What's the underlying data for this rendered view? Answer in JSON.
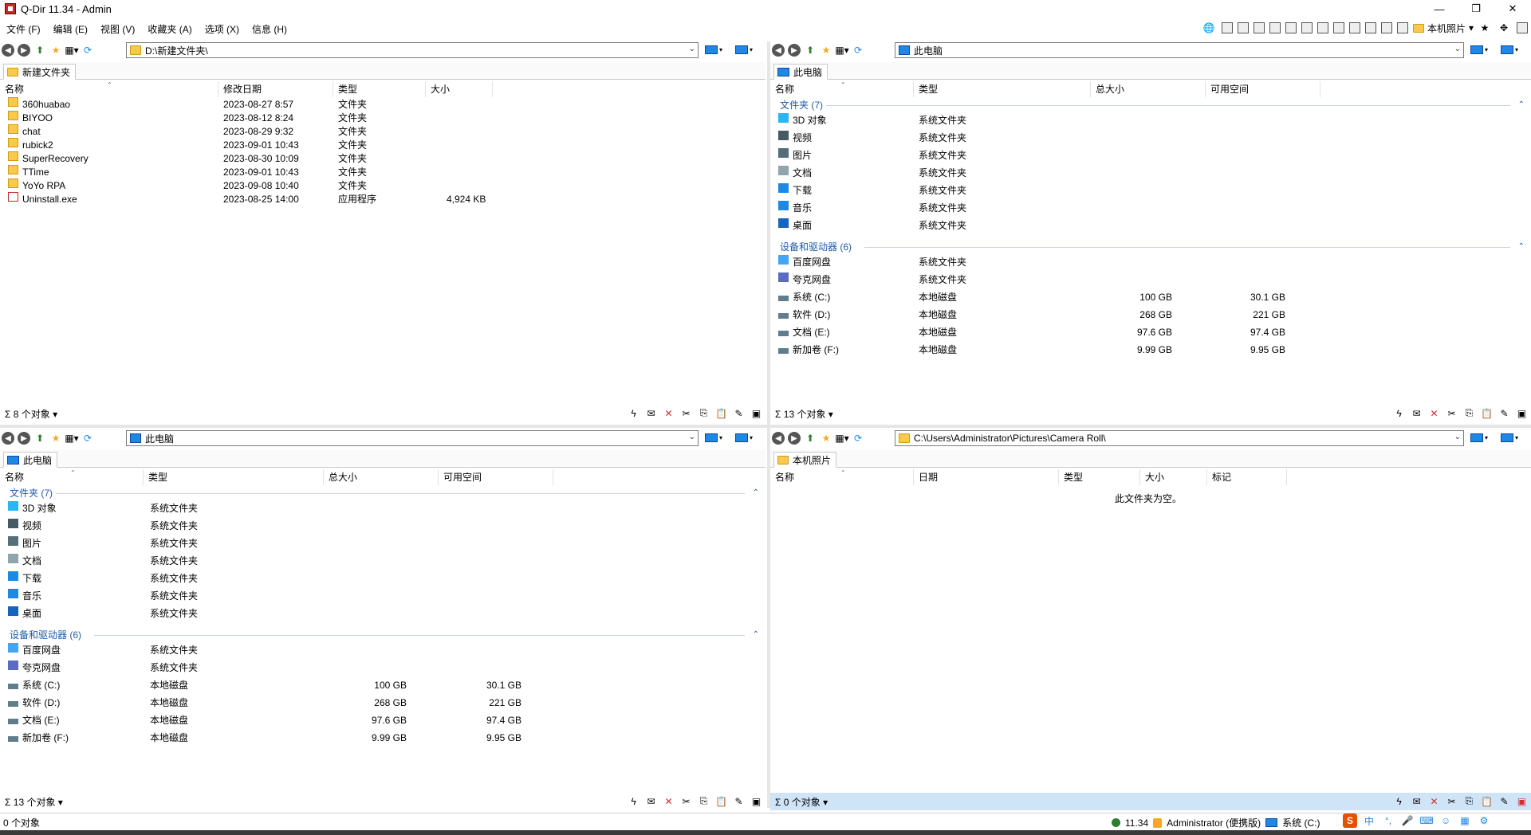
{
  "window": {
    "title": "Q-Dir 11.34 - Admin"
  },
  "menu": [
    "文件 (F)",
    "编辑 (E)",
    "视图 (V)",
    "收藏夹 (A)",
    "选项 (X)",
    "信息 (H)"
  ],
  "toolbar_right": {
    "label": "本机照片"
  },
  "panes": {
    "tl": {
      "address": "D:\\新建文件夹\\",
      "tab": "新建文件夹",
      "columns": [
        "名称",
        "修改日期",
        "类型",
        "大小"
      ],
      "rows": [
        {
          "name": "360huabao",
          "date": "2023-08-27 8:57",
          "type": "文件夹",
          "size": ""
        },
        {
          "name": "BIYOO",
          "date": "2023-08-12 8:24",
          "type": "文件夹",
          "size": ""
        },
        {
          "name": "chat",
          "date": "2023-08-29 9:32",
          "type": "文件夹",
          "size": ""
        },
        {
          "name": "rubick2",
          "date": "2023-09-01 10:43",
          "type": "文件夹",
          "size": ""
        },
        {
          "name": "SuperRecovery",
          "date": "2023-08-30 10:09",
          "type": "文件夹",
          "size": ""
        },
        {
          "name": "TTime",
          "date": "2023-09-01 10:43",
          "type": "文件夹",
          "size": ""
        },
        {
          "name": "YoYo RPA",
          "date": "2023-09-08 10:40",
          "type": "文件夹",
          "size": ""
        },
        {
          "name": "Uninstall.exe",
          "date": "2023-08-25 14:00",
          "type": "应用程序",
          "size": "4,924 KB"
        }
      ],
      "count": "8 个对象"
    },
    "tr": {
      "address": "此电脑",
      "tab": "此电脑",
      "columns": [
        "名称",
        "类型",
        "总大小",
        "可用空间"
      ],
      "group1": "文件夹 (7)",
      "group2": "设备和驱动器 (6)",
      "folders": [
        {
          "name": "3D 对象",
          "type": "系统文件夹"
        },
        {
          "name": "视频",
          "type": "系统文件夹"
        },
        {
          "name": "图片",
          "type": "系统文件夹"
        },
        {
          "name": "文档",
          "type": "系统文件夹"
        },
        {
          "name": "下载",
          "type": "系统文件夹"
        },
        {
          "name": "音乐",
          "type": "系统文件夹"
        },
        {
          "name": "桌面",
          "type": "系统文件夹"
        }
      ],
      "drives": [
        {
          "name": "百度网盘",
          "type": "系统文件夹",
          "total": "",
          "free": ""
        },
        {
          "name": "夸克网盘",
          "type": "系统文件夹",
          "total": "",
          "free": ""
        },
        {
          "name": "系统 (C:)",
          "type": "本地磁盘",
          "total": "100 GB",
          "free": "30.1 GB"
        },
        {
          "name": "软件 (D:)",
          "type": "本地磁盘",
          "total": "268 GB",
          "free": "221 GB"
        },
        {
          "name": "文档 (E:)",
          "type": "本地磁盘",
          "total": "97.6 GB",
          "free": "97.4 GB"
        },
        {
          "name": "新加卷 (F:)",
          "type": "本地磁盘",
          "total": "9.99 GB",
          "free": "9.95 GB"
        }
      ],
      "count": "13 个对象"
    },
    "bl": {
      "address": "此电脑",
      "tab": "此电脑",
      "columns": [
        "名称",
        "类型",
        "总大小",
        "可用空间"
      ],
      "group1": "文件夹 (7)",
      "group2": "设备和驱动器 (6)",
      "folders": [
        {
          "name": "3D 对象",
          "type": "系统文件夹"
        },
        {
          "name": "视频",
          "type": "系统文件夹"
        },
        {
          "name": "图片",
          "type": "系统文件夹"
        },
        {
          "name": "文档",
          "type": "系统文件夹"
        },
        {
          "name": "下载",
          "type": "系统文件夹"
        },
        {
          "name": "音乐",
          "type": "系统文件夹"
        },
        {
          "name": "桌面",
          "type": "系统文件夹"
        }
      ],
      "drives": [
        {
          "name": "百度网盘",
          "type": "系统文件夹",
          "total": "",
          "free": ""
        },
        {
          "name": "夸克网盘",
          "type": "系统文件夹",
          "total": "",
          "free": ""
        },
        {
          "name": "系统 (C:)",
          "type": "本地磁盘",
          "total": "100 GB",
          "free": "30.1 GB"
        },
        {
          "name": "软件 (D:)",
          "type": "本地磁盘",
          "total": "268 GB",
          "free": "221 GB"
        },
        {
          "name": "文档 (E:)",
          "type": "本地磁盘",
          "total": "97.6 GB",
          "free": "97.4 GB"
        },
        {
          "name": "新加卷 (F:)",
          "type": "本地磁盘",
          "total": "9.99 GB",
          "free": "9.95 GB"
        }
      ],
      "count": "13 个对象"
    },
    "br": {
      "address": "C:\\Users\\Administrator\\Pictures\\Camera Roll\\",
      "tab": "本机照片",
      "columns": [
        "名称",
        "日期",
        "类型",
        "大小",
        "标记"
      ],
      "empty": "此文件夹为空。",
      "count": "0 个对象"
    }
  },
  "statusbar": {
    "left": "0 个对象",
    "version": "11.34",
    "user": "Administrator (便携版)",
    "drive": "系统 (C:)"
  },
  "tray": {
    "ime": "中"
  }
}
